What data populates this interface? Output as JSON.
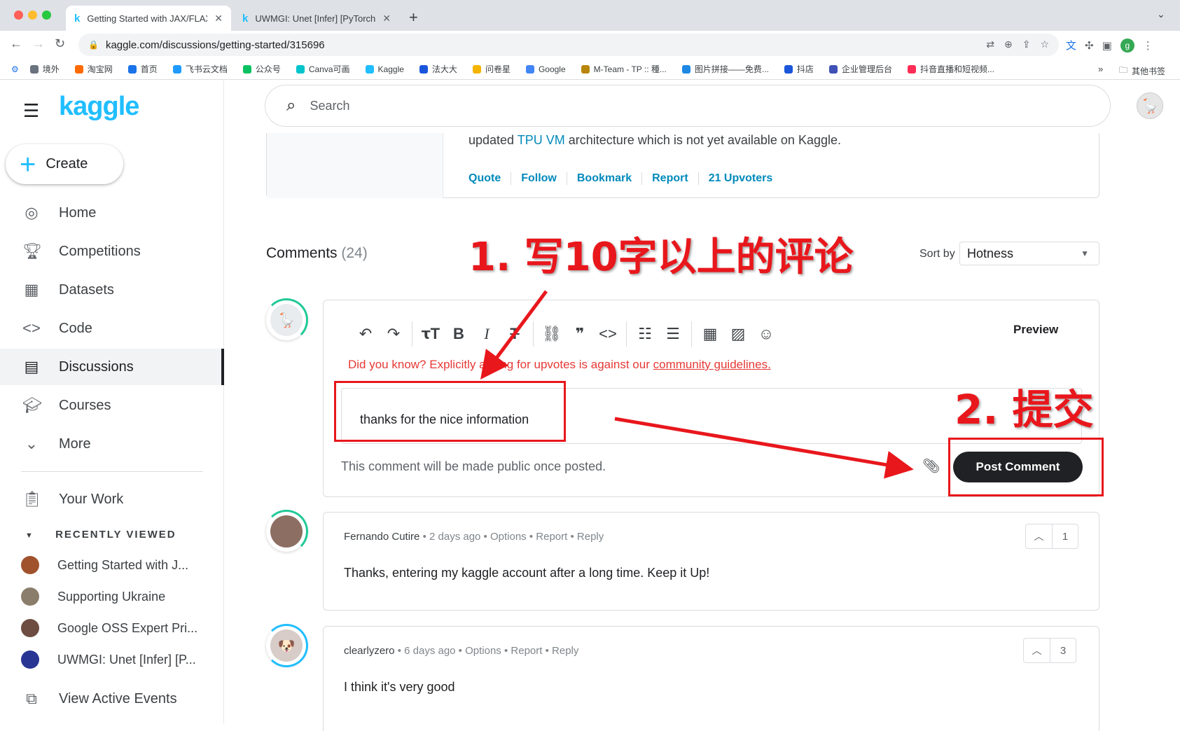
{
  "browser": {
    "tabs": [
      {
        "title": "Getting Started with JAX/FLAX",
        "close": "✕"
      },
      {
        "title": "UWMGI: Unet [Infer] [PyTorch]",
        "close": "✕"
      }
    ],
    "new_tab": "+",
    "url": "kaggle.com/discussions/getting-started/315696",
    "profile_initial": "g",
    "bookmarks": [
      "境外",
      "淘宝网",
      "首页",
      "飞书云文档",
      "公众号",
      "Canva可画",
      "Kaggle",
      "法大大",
      "问卷星",
      "Google",
      "M-Team - TP :: 種...",
      "图片拼接——免费...",
      "抖店",
      "企业管理后台",
      "抖音直播和短视频..."
    ],
    "bookmark_colors": [
      "#6b7280",
      "#ff6a00",
      "#1a73e8",
      "#1f9bff",
      "#07c160",
      "#00c4cc",
      "#20beff",
      "#1a56db",
      "#f4b400",
      "#4285f4",
      "#b8860b",
      "#1e88e5",
      "#1a56db",
      "#3f51b5",
      "#ff2d55"
    ],
    "bookmarks_more": "»",
    "other_bookmarks": "其他书签"
  },
  "sidebar": {
    "logo": "kaggle",
    "create_label": "Create",
    "nav": [
      {
        "label": "Home",
        "icon": "compass-icon"
      },
      {
        "label": "Competitions",
        "icon": "trophy-icon"
      },
      {
        "label": "Datasets",
        "icon": "table-icon"
      },
      {
        "label": "Code",
        "icon": "code-icon"
      },
      {
        "label": "Discussions",
        "icon": "discussion-icon"
      },
      {
        "label": "Courses",
        "icon": "school-icon"
      },
      {
        "label": "More",
        "icon": "chevron-down-icon"
      }
    ],
    "your_work": "Your Work",
    "recently_viewed_label": "RECENTLY VIEWED",
    "recent": [
      {
        "label": "Getting Started with J...",
        "color": "#a0522d"
      },
      {
        "label": "Supporting Ukraine",
        "color": "#8b7d6b"
      },
      {
        "label": "Google OSS Expert Pri...",
        "color": "#6d4c41"
      },
      {
        "label": "UWMGI: Unet [Infer] [P...",
        "color": "#283593"
      }
    ],
    "view_active_events": "View Active Events"
  },
  "search": {
    "placeholder": "Search"
  },
  "topic": {
    "text_prefix": "updated ",
    "text_link": "TPU VM",
    "text_suffix": " architecture which is not yet available on Kaggle.",
    "actions": [
      "Quote",
      "Follow",
      "Bookmark",
      "Report",
      "21 Upvoters"
    ]
  },
  "comments_header": {
    "title": "Comments",
    "count": "(24)"
  },
  "sort": {
    "label": "Sort by",
    "value": "Hotness"
  },
  "editor": {
    "toolbar": [
      "undo-icon",
      "redo-icon",
      "text-size-icon",
      "bold-icon",
      "italic-icon",
      "strikethrough-icon",
      "link-icon",
      "quote-icon",
      "code-icon",
      "numbered-list-icon",
      "bulleted-list-icon",
      "table-icon",
      "image-icon",
      "emoji-icon"
    ],
    "preview_label": "Preview",
    "warning_text": "Did you know? Explicitly asking for upvotes is against our ",
    "warning_link": "community guidelines.",
    "text_value": "thanks for the nice information",
    "public_note": "This comment will be made public once posted.",
    "post_label": "Post Comment"
  },
  "comments": [
    {
      "author": "Fernando Cutire",
      "time": "2 days ago",
      "options": "Options",
      "report": "Report",
      "reply": "Reply",
      "body": "Thanks, entering my kaggle account after a long time. Keep it Up!",
      "votes": "1"
    },
    {
      "author": "clearlyzero",
      "time": "6 days ago",
      "options": "Options",
      "report": "Report",
      "reply": "Reply",
      "body": "I think it's very good",
      "votes": "3"
    }
  ],
  "annotations": {
    "step1": "1. 写10字以上的评论",
    "step2": "2. 提交",
    "color": "#e8171c"
  }
}
